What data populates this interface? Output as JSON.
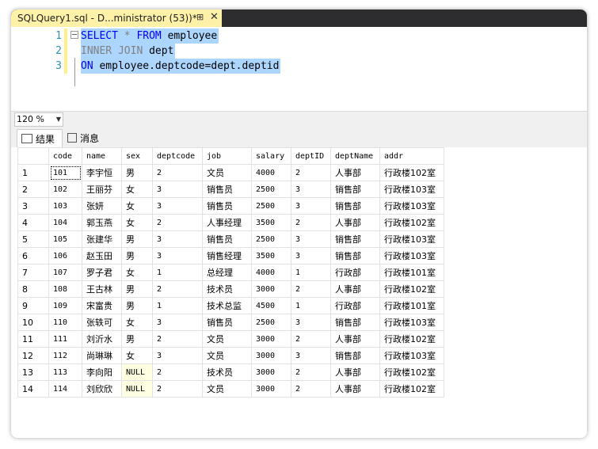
{
  "tab": {
    "title": "SQLQuery1.sql - D...ministrator (53))*",
    "pin": "⊞",
    "close": "✕"
  },
  "editor": {
    "lines": [
      {
        "number": "1",
        "kw1": "SELECT",
        "op": "*",
        "kw2": "FROM",
        "rest": "employee"
      },
      {
        "number": "2",
        "kw1": "INNER JOIN",
        "rest": "dept"
      },
      {
        "number": "3",
        "kw1": "ON",
        "rest": "employee.deptcode=dept.deptid"
      }
    ]
  },
  "zoom": {
    "value": "120 %"
  },
  "result_tabs": [
    {
      "label": "结果",
      "icon": "grid-icon"
    },
    {
      "label": "消息",
      "icon": "message-icon"
    }
  ],
  "grid": {
    "columns": [
      "code",
      "name",
      "sex",
      "deptcode",
      "job",
      "salary",
      "deptID",
      "deptName",
      "addr"
    ],
    "rows": [
      [
        "1",
        "101",
        "李宇恒",
        "男",
        "2",
        "文员",
        "4000",
        "2",
        "人事部",
        "行政楼102室"
      ],
      [
        "2",
        "102",
        "王丽芬",
        "女",
        "3",
        "销售员",
        "2500",
        "3",
        "销售部",
        "行政楼103室"
      ],
      [
        "3",
        "103",
        "张妍",
        "女",
        "3",
        "销售员",
        "2500",
        "3",
        "销售部",
        "行政楼103室"
      ],
      [
        "4",
        "104",
        "郭玉燕",
        "女",
        "2",
        "人事经理",
        "3500",
        "2",
        "人事部",
        "行政楼102室"
      ],
      [
        "5",
        "105",
        "张建华",
        "男",
        "3",
        "销售员",
        "2500",
        "3",
        "销售部",
        "行政楼103室"
      ],
      [
        "6",
        "106",
        "赵玉田",
        "男",
        "3",
        "销售经理",
        "3500",
        "3",
        "销售部",
        "行政楼103室"
      ],
      [
        "7",
        "107",
        "罗子君",
        "女",
        "1",
        "总经理",
        "4000",
        "1",
        "行政部",
        "行政楼101室"
      ],
      [
        "8",
        "108",
        "王古林",
        "男",
        "2",
        "技术员",
        "3000",
        "2",
        "人事部",
        "行政楼102室"
      ],
      [
        "9",
        "109",
        "宋富贵",
        "男",
        "1",
        "技术总监",
        "4500",
        "1",
        "行政部",
        "行政楼101室"
      ],
      [
        "10",
        "110",
        "张轶可",
        "女",
        "3",
        "销售员",
        "2500",
        "3",
        "销售部",
        "行政楼103室"
      ],
      [
        "11",
        "111",
        "刘沂水",
        "男",
        "2",
        "文员",
        "3000",
        "2",
        "人事部",
        "行政楼102室"
      ],
      [
        "12",
        "112",
        "尚琳琳",
        "女",
        "3",
        "文员",
        "3000",
        "3",
        "销售部",
        "行政楼103室"
      ],
      [
        "13",
        "113",
        "李向阳",
        "NULL",
        "2",
        "技术员",
        "3000",
        "2",
        "人事部",
        "行政楼102室"
      ],
      [
        "14",
        "114",
        "刘欣欣",
        "NULL",
        "2",
        "文员",
        "3000",
        "2",
        "人事部",
        "行政楼102室"
      ]
    ]
  }
}
